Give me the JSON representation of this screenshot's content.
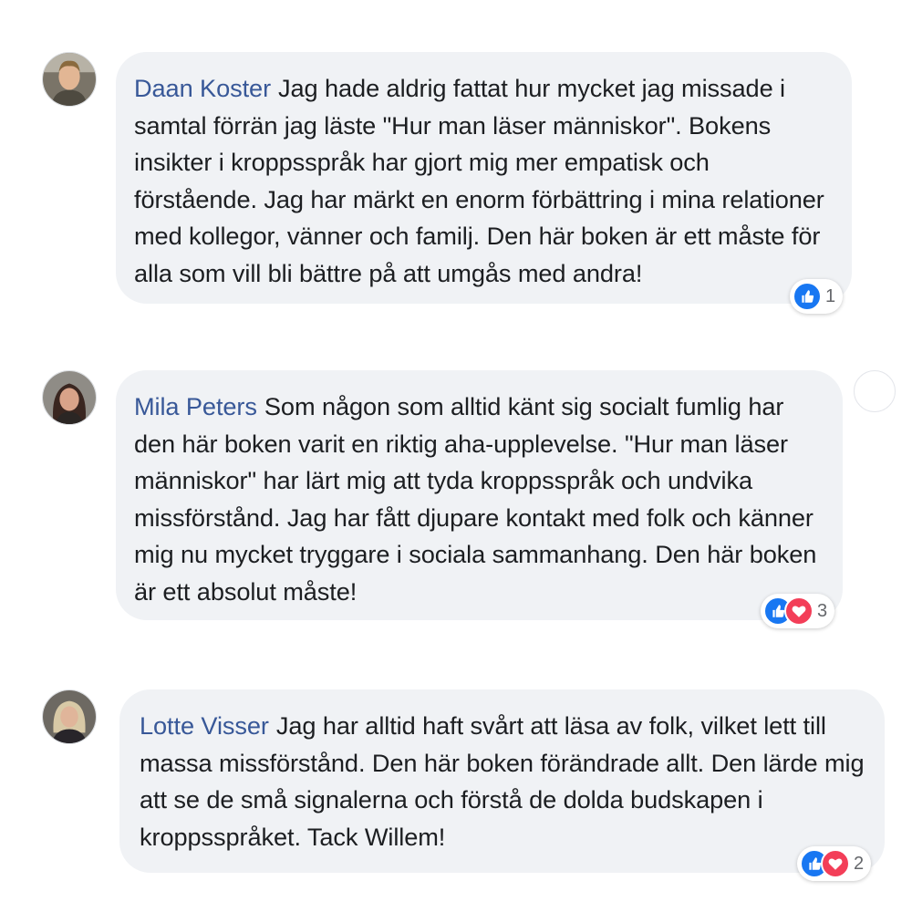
{
  "comments": [
    {
      "author": "Daan Koster",
      "text": "Jag hade aldrig fattat hur mycket jag missade i samtal förrän jag läste \"Hur man läser människor\". Bokens insikter i kroppsspråk har gjort mig mer empatisk och förstående. Jag har märkt en enorm förbättring i mina relationer med kollegor, vänner och familj. Den här boken är ett måste för alla som vill bli bättre på att umgås med andra!",
      "reactions": [
        "like-icon"
      ],
      "reaction_count": "1"
    },
    {
      "author": "Mila Peters",
      "text": "Som någon som alltid känt sig socialt fumlig har den här boken varit en riktig aha-upplevelse. \"Hur man läser människor\" har lärt mig att tyda kroppsspråk och undvika missförstånd. Jag har fått djupare kontakt med folk och känner mig nu mycket tryggare i sociala sammanhang. Den här boken är ett absolut måste!",
      "reactions": [
        "like-icon",
        "love-icon"
      ],
      "reaction_count": "3"
    },
    {
      "author": "Lotte Visser",
      "text": "Jag har alltid haft svårt att läsa av folk, vilket lett till massa missförstånd. Den här boken förändrade allt. Den lärde mig att se de små signalerna och förstå de dolda budskapen i kroppsspråket. Tack Willem!",
      "reactions": [
        "like-icon",
        "love-icon"
      ],
      "reaction_count": "2"
    }
  ],
  "colors": {
    "author": "#385898",
    "bubble": "#f0f2f5",
    "like": "#1877f2",
    "love": "#f33e58"
  }
}
